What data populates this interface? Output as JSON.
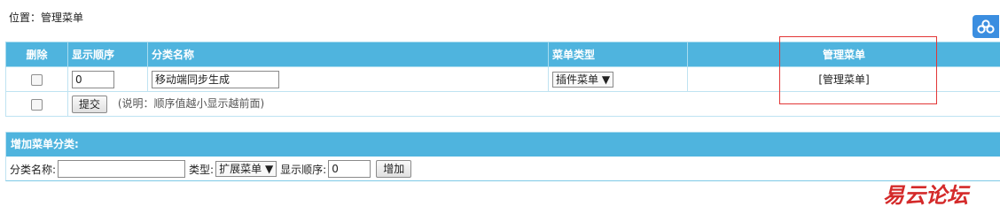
{
  "breadcrumb": "位置：管理菜单",
  "float_button": {
    "icon": "cloud-icon"
  },
  "table": {
    "headers": {
      "delete": "删除",
      "order": "显示顺序",
      "name": "分类名称",
      "type": "菜单类型",
      "manage": "管理菜单"
    },
    "row": {
      "order_value": "0",
      "name_value": "移动端同步生成",
      "type_value": "插件菜单",
      "manage_link": "[管理菜单]"
    },
    "submit_label": "提交",
    "hint": "(说明：顺序值越小显示越前面)"
  },
  "add_section": {
    "title": "增加菜单分类:",
    "name_label": "分类名称:",
    "name_value": "",
    "type_label": "类型:",
    "type_value": "扩展菜单",
    "order_label": "显示顺序:",
    "order_value": "0",
    "add_label": "增加"
  },
  "watermark": "易云论坛",
  "colors": {
    "header": "#4fb4de",
    "accent_red": "#e23636",
    "float_button": "#3b8ee0"
  }
}
